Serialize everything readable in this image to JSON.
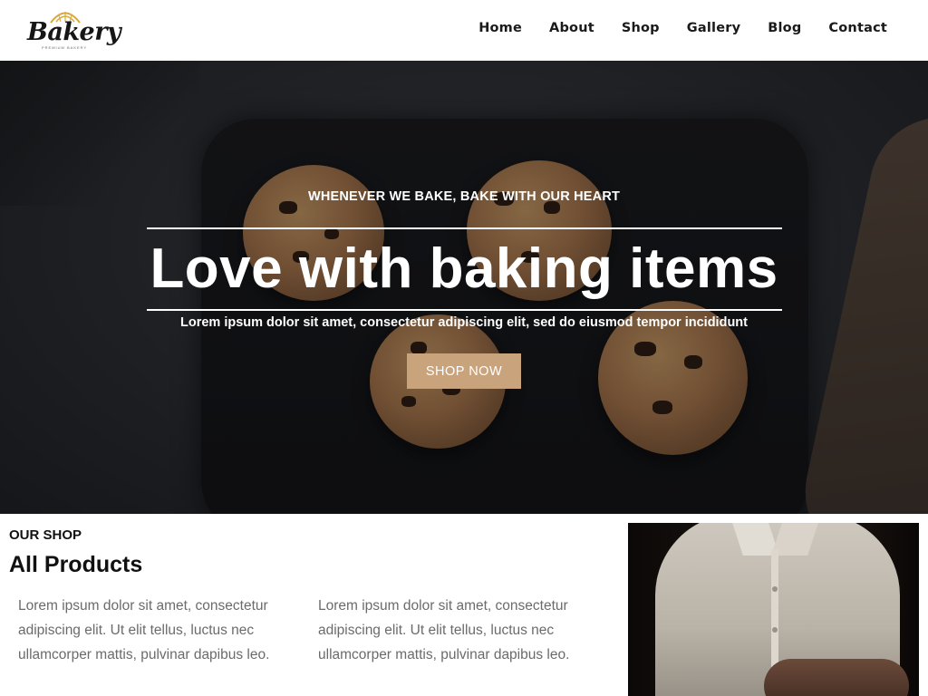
{
  "brand": {
    "name": "Bakery",
    "tagline": "PREMIUM BAKERY",
    "accent": "#c9a37c"
  },
  "nav": {
    "items": [
      {
        "label": "Home"
      },
      {
        "label": "About"
      },
      {
        "label": "Shop"
      },
      {
        "label": "Gallery"
      },
      {
        "label": "Blog"
      },
      {
        "label": "Contact"
      }
    ]
  },
  "hero": {
    "kicker": "WHENEVER WE BAKE, BAKE WITH OUR HEART",
    "title": "Love with baking items",
    "subtitle": "Lorem ipsum dolor sit amet, consectetur adipiscing elit, sed do eiusmod tempor incididunt",
    "button_label": "SHOP NOW"
  },
  "shop": {
    "kicker": "OUR SHOP",
    "title": "All Products",
    "columns": [
      {
        "text": "Lorem ipsum dolor sit amet, consectetur adipiscing elit. Ut elit tellus, luctus nec ullamcorper mattis, pulvinar dapibus leo."
      },
      {
        "text": "Lorem ipsum dolor sit amet, consectetur adipiscing elit. Ut elit tellus, luctus nec ullamcorper mattis, pulvinar dapibus leo."
      }
    ]
  }
}
